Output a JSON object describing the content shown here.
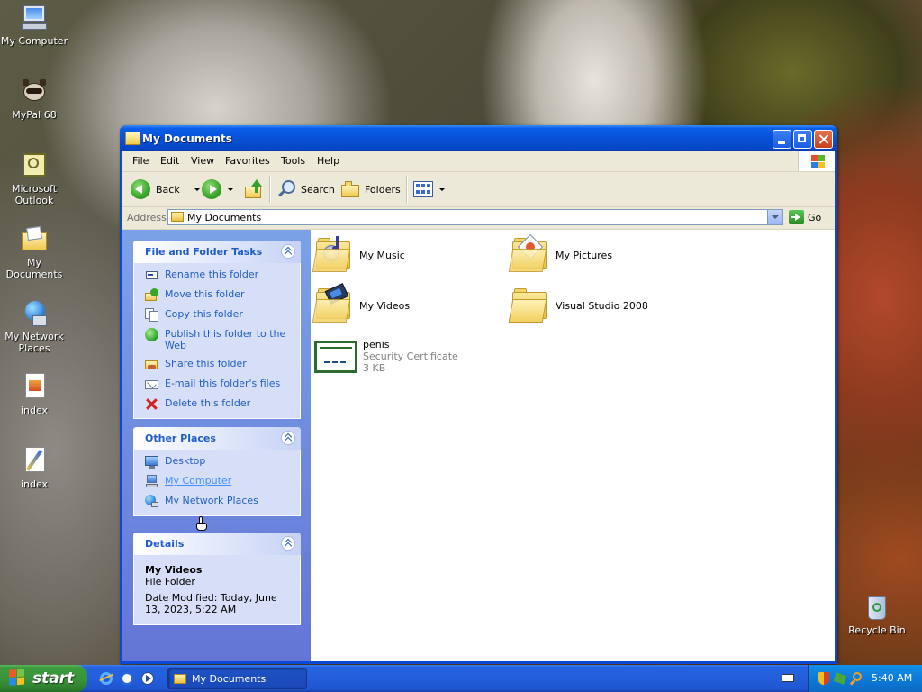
{
  "desktop": {
    "icons": [
      {
        "label": "My Computer"
      },
      {
        "label": "MyPal 68"
      },
      {
        "label": "Microsoft Outlook"
      },
      {
        "label": "My Documents"
      },
      {
        "label": "My Network Places"
      },
      {
        "label": "index"
      },
      {
        "label": "index"
      },
      {
        "label": "Recycle Bin"
      }
    ]
  },
  "window": {
    "title": "My Documents",
    "menu": [
      "File",
      "Edit",
      "View",
      "Favorites",
      "Tools",
      "Help"
    ],
    "toolbar": {
      "back_label": "Back",
      "search_label": "Search",
      "folders_label": "Folders"
    },
    "address": {
      "label": "Address",
      "value": "My Documents",
      "go_label": "Go"
    },
    "panels": {
      "tasks": {
        "title": "File and Folder Tasks",
        "items": [
          {
            "label": "Rename this folder",
            "icon": "rename-icon"
          },
          {
            "label": "Move this folder",
            "icon": "move-icon"
          },
          {
            "label": "Copy this folder",
            "icon": "copy-icon"
          },
          {
            "label": "Publish this folder to the Web",
            "icon": "publish-web-icon"
          },
          {
            "label": "Share this folder",
            "icon": "share-icon"
          },
          {
            "label": "E-mail this folder's files",
            "icon": "email-icon"
          },
          {
            "label": "Delete this folder",
            "icon": "delete-icon"
          }
        ]
      },
      "places": {
        "title": "Other Places",
        "items": [
          {
            "label": "Desktop",
            "icon": "desktop-icon"
          },
          {
            "label": "My Computer",
            "icon": "computer-icon"
          },
          {
            "label": "My Network Places",
            "icon": "network-places-icon"
          }
        ]
      },
      "details": {
        "title": "Details",
        "name": "My Videos",
        "type": "File Folder",
        "modified": "Date Modified: Today, June 13, 2023, 5:22 AM"
      }
    },
    "files": [
      {
        "name": "My Music",
        "icon": "music-folder-icon"
      },
      {
        "name": "My Pictures",
        "icon": "pictures-folder-icon"
      },
      {
        "name": "My Videos",
        "icon": "videos-folder-icon"
      },
      {
        "name": "Visual Studio 2008",
        "icon": "folder-icon"
      },
      {
        "name": "penis",
        "type": "Security Certificate",
        "size": "3 KB",
        "icon": "certificate-icon"
      }
    ]
  },
  "taskbar": {
    "start_label": "start",
    "task_label": "My Documents",
    "clock": "5:40 AM"
  }
}
